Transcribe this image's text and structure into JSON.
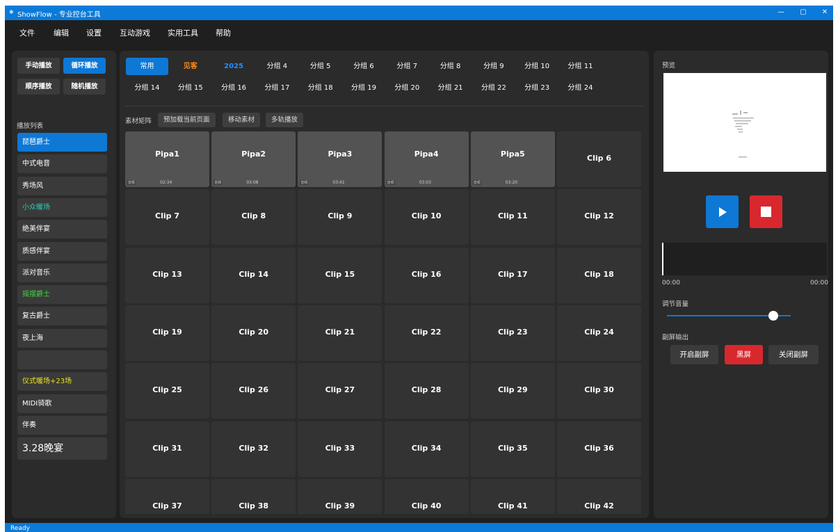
{
  "window": {
    "title": "ShowFlow - 专业控台工具",
    "controls": [
      "—",
      "▢",
      "✕"
    ]
  },
  "menu": [
    "文件",
    "编辑",
    "设置",
    "互动游戏",
    "实用工具",
    "帮助"
  ],
  "left": {
    "modes": [
      {
        "label": "手动播放",
        "active": false
      },
      {
        "label": "循环播放",
        "active": true
      },
      {
        "label": "顺序播放",
        "active": false
      },
      {
        "label": "随机播放",
        "active": false
      }
    ],
    "playlist_label": "播放列表",
    "playlist": [
      {
        "label": "琵琶爵士",
        "color": "#ffffff",
        "selected": true
      },
      {
        "label": "中式电音",
        "color": "#ffffff"
      },
      {
        "label": "秀场风",
        "color": "#ffffff"
      },
      {
        "label": "小众暖场",
        "color": "#2ad0b8"
      },
      {
        "label": "绝美伴宴",
        "color": "#ffffff"
      },
      {
        "label": "质感伴宴",
        "color": "#ffffff"
      },
      {
        "label": "派对音乐",
        "color": "#ffffff"
      },
      {
        "label": "摇摆爵士",
        "color": "#3fd33f"
      },
      {
        "label": "复古爵士",
        "color": "#ffffff"
      },
      {
        "label": "夜上海",
        "color": "#ffffff"
      },
      {
        "label": "",
        "color": "#ffffff"
      },
      {
        "label": "仪式暖场+23场",
        "color": "#f0e31c"
      },
      {
        "label": "MIDI骑歌",
        "color": "#ffffff"
      },
      {
        "label": "伴奏",
        "color": "#ffffff"
      },
      {
        "label": "3.28晚宴",
        "color": "#ffffff",
        "big": true
      }
    ]
  },
  "center": {
    "groups": [
      {
        "label": "常用",
        "active": true
      },
      {
        "label": "见客",
        "color": "#ff8c1a"
      },
      {
        "label": "2025",
        "color": "#1e8fff"
      },
      {
        "label": "分组 4"
      },
      {
        "label": "分组 5"
      },
      {
        "label": "分组 6"
      },
      {
        "label": "分组 7"
      },
      {
        "label": "分组 8"
      },
      {
        "label": "分组 9"
      },
      {
        "label": "分组 10"
      },
      {
        "label": "分组 11"
      },
      {
        "label": "分组 14"
      },
      {
        "label": "分组 15"
      },
      {
        "label": "分组 16"
      },
      {
        "label": "分组 17"
      },
      {
        "label": "分组 18"
      },
      {
        "label": "分组 19"
      },
      {
        "label": "分组 20"
      },
      {
        "label": "分组 21"
      },
      {
        "label": "分组 22"
      },
      {
        "label": "分组 23"
      },
      {
        "label": "分组 24"
      }
    ],
    "matrix_label": "素材矩阵",
    "tools": [
      "预加载当前页面",
      "移动素材",
      "多轨播放"
    ],
    "clips": [
      {
        "name": "Pipa1",
        "badge": "音频",
        "duration": "02:34"
      },
      {
        "name": "Pipa2",
        "badge": "音频",
        "duration": "03:08"
      },
      {
        "name": "Pipa3",
        "badge": "音频",
        "duration": "03:41"
      },
      {
        "name": "Pipa4",
        "badge": "音频",
        "duration": "03:03"
      },
      {
        "name": "Pipa5",
        "badge": "音频",
        "duration": "03:20"
      },
      {
        "name": "Clip 6"
      },
      {
        "name": "Clip 7"
      },
      {
        "name": "Clip 8"
      },
      {
        "name": "Clip 9"
      },
      {
        "name": "Clip 10"
      },
      {
        "name": "Clip 11"
      },
      {
        "name": "Clip 12"
      },
      {
        "name": "Clip 13"
      },
      {
        "name": "Clip 14"
      },
      {
        "name": "Clip 15"
      },
      {
        "name": "Clip 16"
      },
      {
        "name": "Clip 17"
      },
      {
        "name": "Clip 18"
      },
      {
        "name": "Clip 19"
      },
      {
        "name": "Clip 20"
      },
      {
        "name": "Clip 21"
      },
      {
        "name": "Clip 22"
      },
      {
        "name": "Clip 23"
      },
      {
        "name": "Clip 24"
      },
      {
        "name": "Clip 25"
      },
      {
        "name": "Clip 26"
      },
      {
        "name": "Clip 27"
      },
      {
        "name": "Clip 28"
      },
      {
        "name": "Clip 29"
      },
      {
        "name": "Clip 30"
      },
      {
        "name": "Clip 31"
      },
      {
        "name": "Clip 32"
      },
      {
        "name": "Clip 33"
      },
      {
        "name": "Clip 34"
      },
      {
        "name": "Clip 35"
      },
      {
        "name": "Clip 36"
      },
      {
        "name": "Clip 37"
      },
      {
        "name": "Clip 38"
      },
      {
        "name": "Clip 39"
      },
      {
        "name": "Clip 40"
      },
      {
        "name": "Clip 41"
      },
      {
        "name": "Clip 42"
      }
    ]
  },
  "right": {
    "preview_label": "预览",
    "play_icon": "play-icon",
    "stop_icon": "stop-icon",
    "time_start": "00:00",
    "time_end": "00:00",
    "volume_label": "调节音量",
    "volume_level": 0.86,
    "subscreen_label": "副屏输出",
    "subscreen_buttons": [
      "开启副屏",
      "黑屏",
      "关闭副屏"
    ]
  },
  "status": "Ready",
  "colors": {
    "accent": "#0e78d5",
    "titlebar": "#0b7ad8",
    "danger": "#d9272e",
    "panel": "#2b2b2b"
  }
}
